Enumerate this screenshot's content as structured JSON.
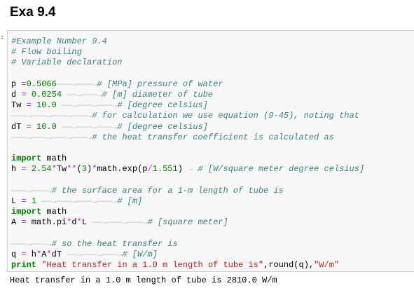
{
  "title": "Exa 9.4",
  "cell_marker": ":",
  "code": {
    "c1": "#Example Number 9.4",
    "c2": "# Flow boiling",
    "c3": "# Variable declaration",
    "l_p": {
      "name": "p ",
      "eq": "=",
      "val": "0.5066",
      "tabs": "———→———→",
      "comment": "# [MPa] pressure of water"
    },
    "l_d": {
      "name": "d ",
      "eq": "=",
      "val": "0.0254",
      "tabs": "——→———→",
      "comment": "# [m] diameter of tube"
    },
    "l_tw": {
      "name": "Tw ",
      "eq": "=",
      "val": "10.0",
      "tabs": "——→———→———→",
      "comment": "# [degree celsius]"
    },
    "l_note1": {
      "tabs": "———→———→———→———→",
      "comment": "# for calculation we use equation (9-45), noting that"
    },
    "l_dt": {
      "name": "dT ",
      "eq": "=",
      "val": "10.0",
      "tabs": "——→———→———→",
      "comment": "# [degree celsius]"
    },
    "l_note2": {
      "tabs": "———→———→———→———→",
      "comment": "# the heat transfer coefficient is calculated as"
    },
    "import1": {
      "kw": "import",
      "mod": " math"
    },
    "l_h": {
      "a": "h ",
      "b": "=",
      "c": " ",
      "d": "2.54",
      "e": "*",
      "f": "Tw",
      "g": "**",
      "h": "(",
      "i": "3",
      "j": ")",
      "k": "*",
      "l": "math.exp(p",
      "m": "/",
      "n": "1.551",
      "o": ")",
      "tabs": " → ",
      "comment": "# [W/square meter degree celsius]"
    },
    "l_note3": {
      "tabs": "———→———→",
      "comment": "# the surface area for a 1-m length of tube is"
    },
    "l_l": {
      "name": "L ",
      "eq": "=",
      "val": "1",
      "tabs": " ——→———→———→———→",
      "comment": "# [m]"
    },
    "import2": {
      "kw": "import",
      "mod": " math"
    },
    "l_a": {
      "a": "A ",
      "b": "=",
      "c": " math.pi",
      "d": "*",
      "e": "d",
      "f": "*",
      "g": "L",
      "tabs": " ——→———→———→",
      "comment": "# [square meter]"
    },
    "l_note4": {
      "tabs": "———→———→",
      "comment": "# so the heat transfer is"
    },
    "l_q": {
      "a": "q ",
      "b": "=",
      "c": " h",
      "d": "*",
      "e": "A",
      "f": "*",
      "g": "dT",
      "tabs": " ——→———→———→",
      "comment": "# [W/m]"
    },
    "l_print": {
      "kw": "print",
      "s1": "\"Heat transfer in a 1.0 m length of tube is\"",
      "mid": ",round(q),",
      "s2": "\"W/m\""
    }
  },
  "output": "Heat transfer in a 1.0 m length of tube is 2810.0 W/m"
}
